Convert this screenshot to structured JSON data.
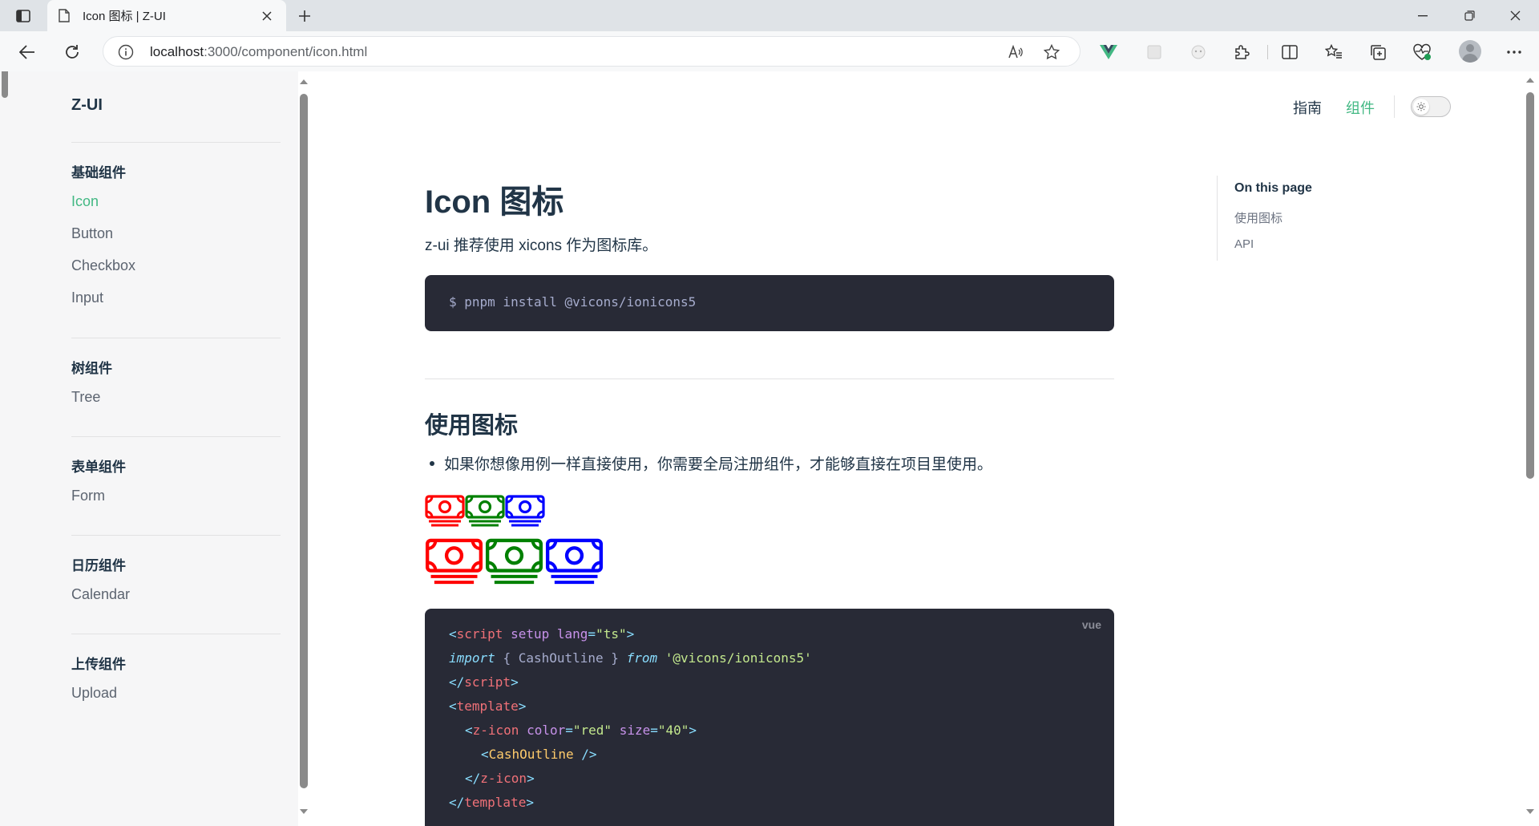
{
  "browser": {
    "tab_title": "Icon 图标 | Z-UI",
    "url_host": "localhost",
    "url_rest": ":3000/component/icon.html"
  },
  "sidebar": {
    "brand": "Z-UI",
    "groups": [
      {
        "title": "基础组件",
        "items": [
          "Icon",
          "Button",
          "Checkbox",
          "Input"
        ]
      },
      {
        "title": "树组件",
        "items": [
          "Tree"
        ]
      },
      {
        "title": "表单组件",
        "items": [
          "Form"
        ]
      },
      {
        "title": "日历组件",
        "items": [
          "Calendar"
        ]
      },
      {
        "title": "上传组件",
        "items": [
          "Upload"
        ]
      }
    ],
    "active_item": "Icon"
  },
  "topnav": {
    "guide": "指南",
    "components": "组件"
  },
  "colors": {
    "accent": "#42b883",
    "code_bg": "#282a36",
    "icon_red": "#ff0000",
    "icon_green": "#008000",
    "icon_blue": "#0000ff"
  },
  "main": {
    "title": "Icon 图标",
    "intro": "z-ui 推荐使用 xicons 作为图标库。",
    "install_cmd": "$ pnpm install @vicons/ionicons5",
    "section_title": "使用图标",
    "bullet": "如果你想像用例一样直接使用，你需要全局注册组件，才能够直接在项目里使用。",
    "code_lang": "vue",
    "code": {
      "l1_open": "<",
      "l1_tag": "script",
      "l1_attr1": "setup",
      "l1_attr2": "lang",
      "l1_eq": "=",
      "l1_val": "\"ts\"",
      "l1_close": ">",
      "l2_kw1": "import",
      "l2_mid": "{ CashOutline }",
      "l2_kw2": "from",
      "l2_str": "'@vicons/ionicons5'",
      "l3_open": "</",
      "l3_tag": "script",
      "l3_close": ">",
      "l4_open": "<",
      "l4_tag": "template",
      "l4_close": ">",
      "l5_open": "<",
      "l5_tag": "z-icon",
      "l5_attr1": "color",
      "l5_val1": "\"red\"",
      "l5_attr2": "size",
      "l5_val2": "\"40\"",
      "l5_close": ">",
      "l6_open": "<",
      "l6_tag": "CashOutline",
      "l6_close": "/>",
      "l7_open": "</",
      "l7_tag": "z-icon",
      "l7_close": ">",
      "l8_open": "</",
      "l8_tag": "template",
      "l8_close": ">"
    }
  },
  "toc": {
    "title": "On this page",
    "items": [
      "使用图标",
      "API"
    ]
  }
}
